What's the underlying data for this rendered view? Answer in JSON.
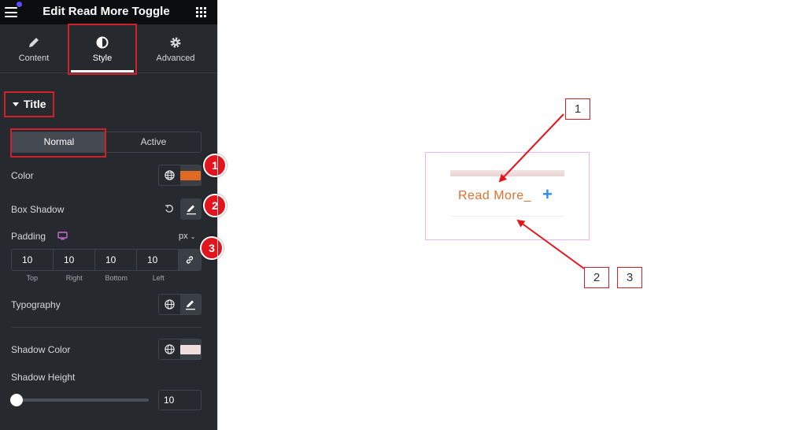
{
  "header": {
    "title": "Edit Read More Toggle",
    "menu_icon": "hamburger-icon",
    "apps_icon": "grid-icon"
  },
  "tabs": [
    {
      "label": "Content",
      "icon": "pencil-icon",
      "active": false
    },
    {
      "label": "Style",
      "icon": "half-circle-icon",
      "active": true
    },
    {
      "label": "Advanced",
      "icon": "gear-icon",
      "active": false
    }
  ],
  "section": {
    "title": "Title",
    "state_tabs": [
      "Normal",
      "Active"
    ],
    "active_state": "Normal"
  },
  "controls": {
    "color": {
      "label": "Color",
      "value": "#e06a24"
    },
    "box_shadow": {
      "label": "Box Shadow"
    },
    "padding": {
      "label": "Padding",
      "unit": "px",
      "values": [
        "10",
        "10",
        "10",
        "10"
      ],
      "sides": [
        "Top",
        "Right",
        "Bottom",
        "Left"
      ]
    },
    "typography": {
      "label": "Typography"
    },
    "shadow_color": {
      "label": "Shadow Color",
      "value": "#f0dcdc"
    },
    "shadow_height": {
      "label": "Shadow Height",
      "value": "10",
      "fraction": 0.0
    }
  },
  "badges": [
    "1",
    "2",
    "3"
  ],
  "preview": {
    "link_text": "Read More_",
    "toggle_icon": "+",
    "accent_text_color": "#e0702e",
    "toggle_color": "#2f8ce8"
  },
  "callouts": [
    "1",
    "2",
    "3"
  ],
  "colors": {
    "panel_bg": "#26292e",
    "topbar_bg": "#0c0d0e",
    "highlight_red": "#d0202a",
    "preview_border": "#e6b4f0"
  }
}
